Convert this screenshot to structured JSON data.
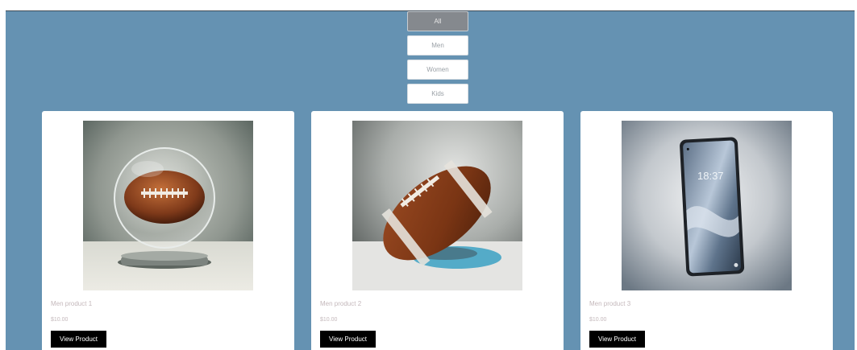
{
  "filters": [
    {
      "label": "All",
      "active": true
    },
    {
      "label": "Men",
      "active": false
    },
    {
      "label": "Women",
      "active": false
    },
    {
      "label": "Kids",
      "active": false
    }
  ],
  "products": [
    {
      "name": "Men product 1",
      "price": "$10.00",
      "button": "View Product",
      "image": "football-in-glass-sphere-image"
    },
    {
      "name": "Men product 2",
      "price": "$10.00",
      "button": "View Product",
      "image": "football-image"
    },
    {
      "name": "Men product 3",
      "price": "$10.00",
      "button": "View Product",
      "image": "smartphone-image",
      "screen_time": "18:37"
    }
  ],
  "colors": {
    "page_bg": "#6592b2",
    "card_bg": "#ffffff",
    "active_filter": "#85898e",
    "button_bg": "#000000",
    "muted_text": "#c4b8bb"
  }
}
